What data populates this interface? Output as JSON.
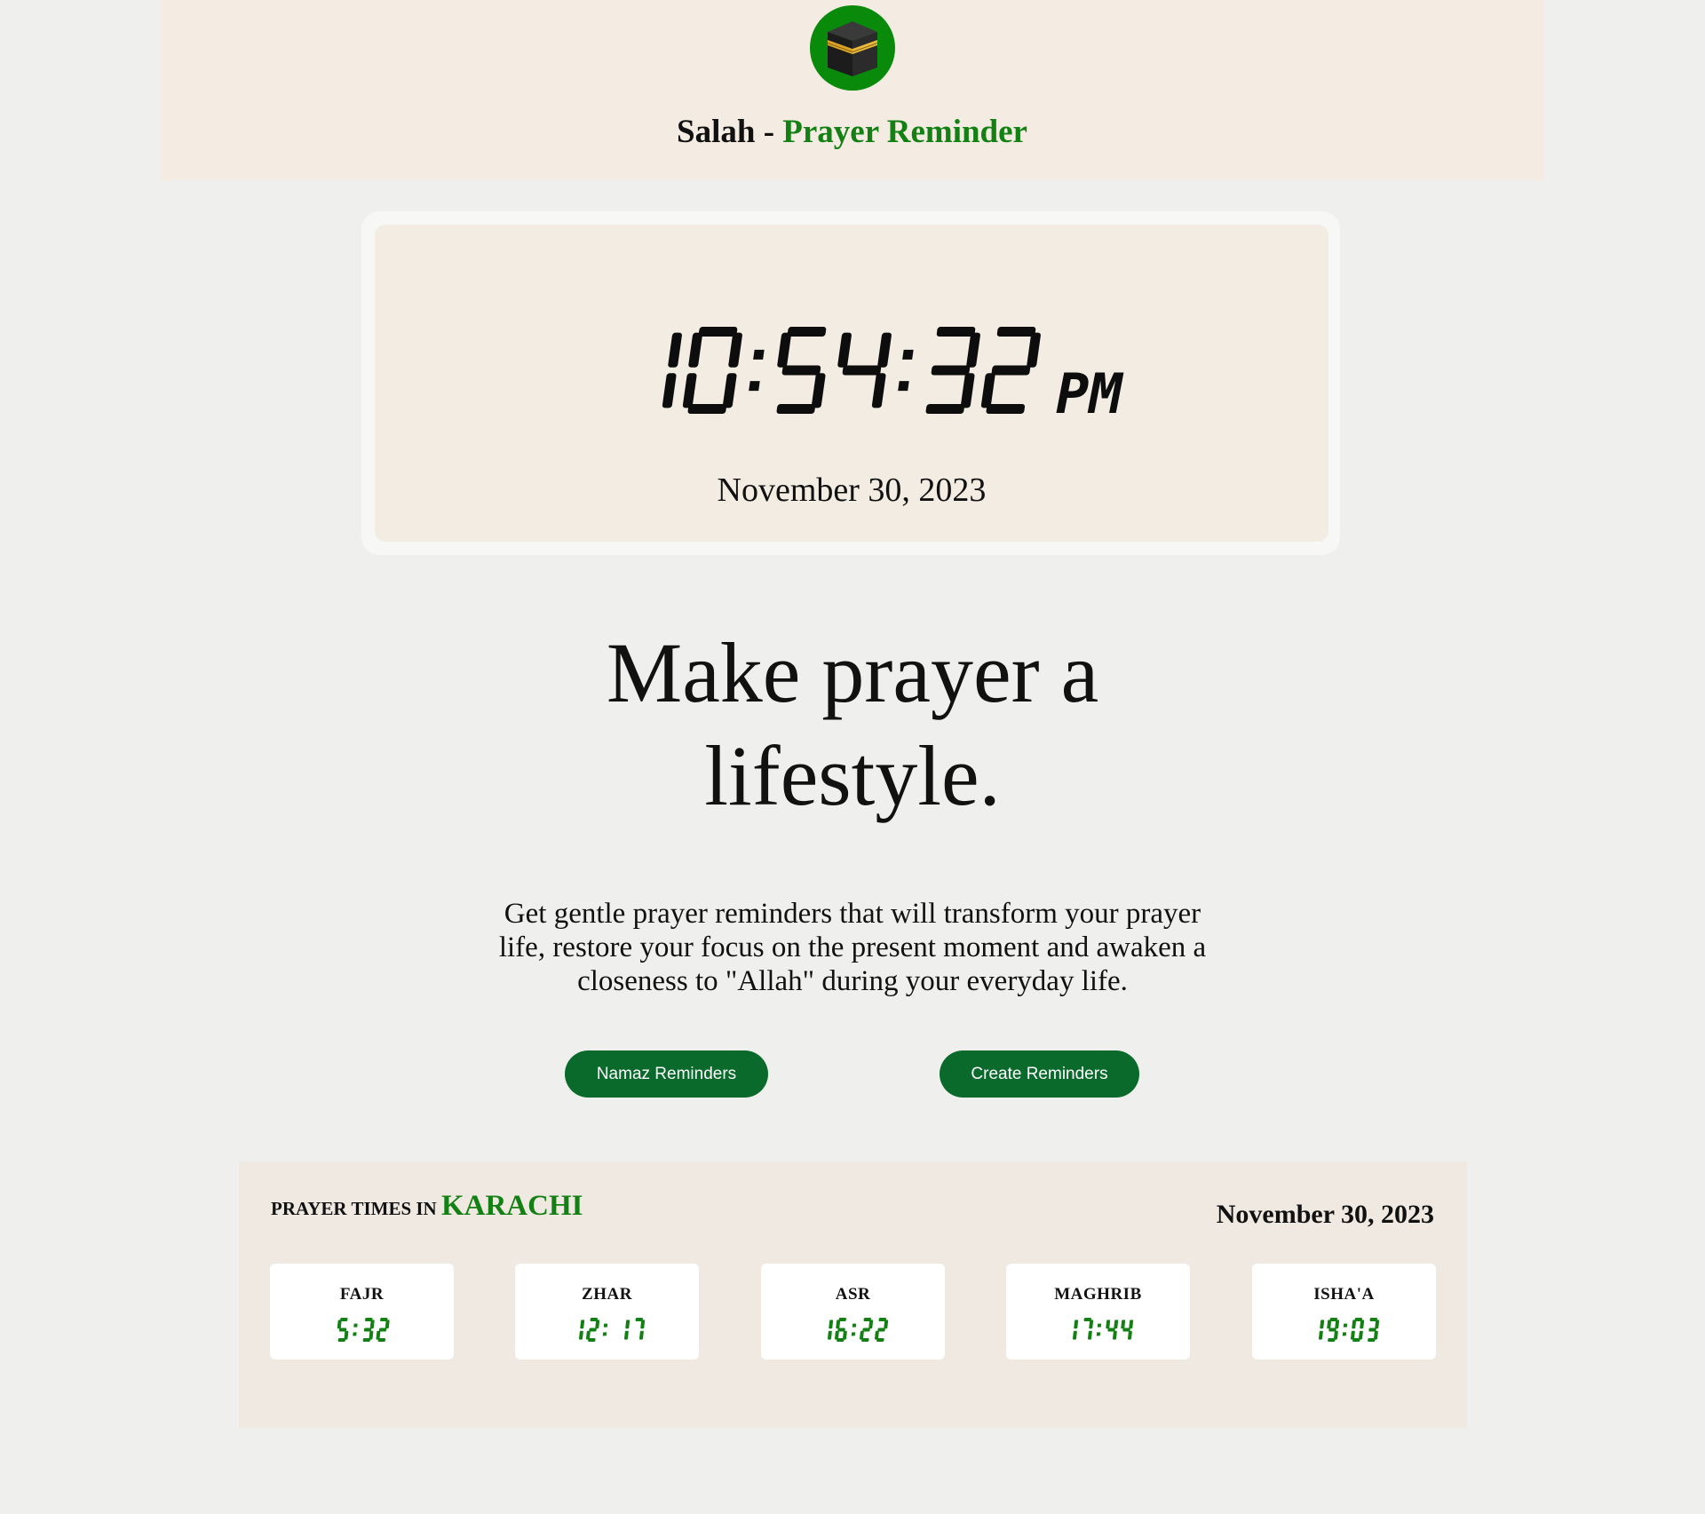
{
  "header": {
    "logo_icon": "kaaba-icon",
    "title_brand": "Salah",
    "title_separator": "-",
    "title_accent": "Prayer Reminder"
  },
  "clock": {
    "time": "10:54:32",
    "period": "PM",
    "date": "November 30, 2023"
  },
  "hero": {
    "headline": "Make prayer a lifestyle.",
    "tagline": "Get gentle prayer reminders that will transform your prayer life, restore your focus on the present moment and awaken a closeness to \"Allah\" during your everyday life."
  },
  "buttons": {
    "namaz_label": "Namaz Reminders",
    "create_label": "Create Reminders"
  },
  "prayer_times": {
    "heading_prefix": "PRAYER TIMES IN",
    "city": "KARACHI",
    "date": "November 30, 2023",
    "items": [
      {
        "name": "FAJR",
        "time": "5:32"
      },
      {
        "name": "ZHAR",
        "time": "12: 17"
      },
      {
        "name": "ASR",
        "time": "16:22"
      },
      {
        "name": "MAGHRIB",
        "time": "17:44"
      },
      {
        "name": "ISHA'A",
        "time": "19:03"
      }
    ]
  },
  "colors": {
    "accent_green": "#138013",
    "button_green": "#096a2b",
    "header_bg": "#f4ece2",
    "page_bg": "#eff0ed"
  }
}
